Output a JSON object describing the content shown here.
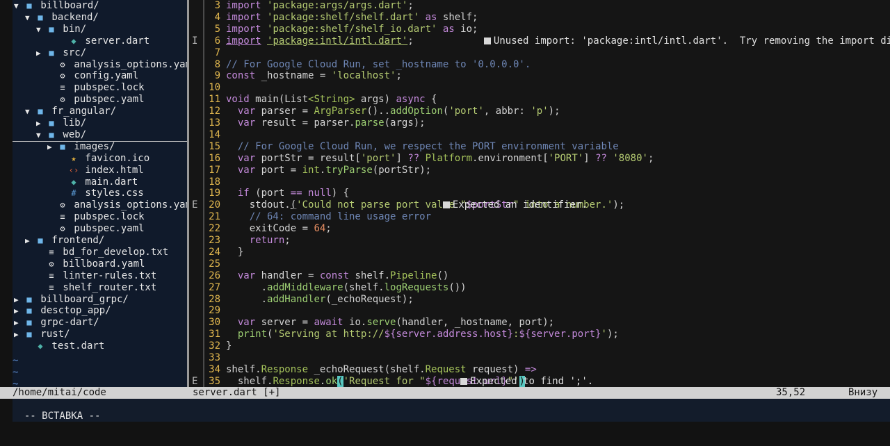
{
  "file_tree": {
    "rows": [
      {
        "arrow": "▼",
        "icon": "■",
        "icon_color": "#6fb6e9",
        "label": "billboard/",
        "indent": 0
      },
      {
        "arrow": "▼",
        "icon": "■",
        "icon_color": "#6fb6e9",
        "label": "backend/",
        "indent": 1
      },
      {
        "arrow": "▼",
        "icon": "■",
        "icon_color": "#6fb6e9",
        "label": "bin/",
        "indent": 2
      },
      {
        "arrow": "",
        "icon": "◆",
        "icon_color": "#4fb3a9",
        "label": "server.dart",
        "indent": 4
      },
      {
        "arrow": "▶",
        "icon": "■",
        "icon_color": "#6fb6e9",
        "label": "src/",
        "indent": 2
      },
      {
        "arrow": "",
        "icon": "⚙",
        "icon_color": "#e6e6e6",
        "label": "analysis_options.yaml",
        "indent": 3
      },
      {
        "arrow": "",
        "icon": "⚙",
        "icon_color": "#e6e6e6",
        "label": "config.yaml",
        "indent": 3
      },
      {
        "arrow": "",
        "icon": "≡",
        "icon_color": "#e6e6e6",
        "label": "pubspec.lock",
        "indent": 3
      },
      {
        "arrow": "",
        "icon": "⚙",
        "icon_color": "#e6e6e6",
        "label": "pubspec.yaml",
        "indent": 3
      },
      {
        "arrow": "▼",
        "icon": "■",
        "icon_color": "#6fb6e9",
        "label": "fr_angular/",
        "indent": 1
      },
      {
        "arrow": "▶",
        "icon": "■",
        "icon_color": "#6fb6e9",
        "label": "lib/",
        "indent": 2
      },
      {
        "arrow": "▼",
        "icon": "■",
        "icon_color": "#6fb6e9",
        "label": "web/",
        "indent": 2,
        "highlight": true
      },
      {
        "arrow": "▶",
        "icon": "■",
        "icon_color": "#6fb6e9",
        "label": "images/",
        "indent": 3
      },
      {
        "arrow": "",
        "icon": "★",
        "icon_color": "#e5b33f",
        "label": "favicon.ico",
        "indent": 4
      },
      {
        "arrow": "",
        "icon": "‹›",
        "icon_color": "#e3653b",
        "label": "index.html",
        "indent": 4
      },
      {
        "arrow": "",
        "icon": "◆",
        "icon_color": "#4fb3a9",
        "label": "main.dart",
        "indent": 4
      },
      {
        "arrow": "",
        "icon": "#",
        "icon_color": "#5b9bd5",
        "label": "styles.css",
        "indent": 4
      },
      {
        "arrow": "",
        "icon": "⚙",
        "icon_color": "#e6e6e6",
        "label": "analysis_options.yaml",
        "indent": 3
      },
      {
        "arrow": "",
        "icon": "≡",
        "icon_color": "#e6e6e6",
        "label": "pubspec.lock",
        "indent": 3
      },
      {
        "arrow": "",
        "icon": "⚙",
        "icon_color": "#e6e6e6",
        "label": "pubspec.yaml",
        "indent": 3
      },
      {
        "arrow": "▶",
        "icon": "■",
        "icon_color": "#6fb6e9",
        "label": "frontend/",
        "indent": 1
      },
      {
        "arrow": "",
        "icon": "≡",
        "icon_color": "#e6e6e6",
        "label": "bd_for_develop.txt",
        "indent": 2
      },
      {
        "arrow": "",
        "icon": "⚙",
        "icon_color": "#e6e6e6",
        "label": "billboard.yaml",
        "indent": 2
      },
      {
        "arrow": "",
        "icon": "≡",
        "icon_color": "#e6e6e6",
        "label": "linter-rules.txt",
        "indent": 2
      },
      {
        "arrow": "",
        "icon": "≡",
        "icon_color": "#e6e6e6",
        "label": "shelf_router.txt",
        "indent": 2
      },
      {
        "arrow": "▶",
        "icon": "■",
        "icon_color": "#6fb6e9",
        "label": "billboard_grpc/",
        "indent": 0
      },
      {
        "arrow": "▶",
        "icon": "■",
        "icon_color": "#6fb6e9",
        "label": "desctop_app/",
        "indent": 0
      },
      {
        "arrow": "▶",
        "icon": "■",
        "icon_color": "#6fb6e9",
        "label": "grpc-dart/",
        "indent": 0
      },
      {
        "arrow": "▶",
        "icon": "■",
        "icon_color": "#6fb6e9",
        "label": "rust/",
        "indent": 0
      },
      {
        "arrow": "",
        "icon": "◆",
        "icon_color": "#4fb3a9",
        "label": "test.dart",
        "indent": 1
      }
    ],
    "tildes": [
      "~",
      "~",
      "~"
    ]
  },
  "editor": {
    "lines": [
      {
        "num": "3",
        "sign": "",
        "segments": [
          {
            "t": "import",
            "c": "k"
          },
          {
            "t": " "
          },
          {
            "t": "'package:args/args.dart'",
            "c": "s"
          },
          {
            "t": ";"
          }
        ]
      },
      {
        "num": "4",
        "sign": "",
        "segments": [
          {
            "t": "import",
            "c": "k"
          },
          {
            "t": " "
          },
          {
            "t": "'package:shelf/shelf.dart'",
            "c": "s"
          },
          {
            "t": " as ",
            "c": "k"
          },
          {
            "t": "shelf;"
          }
        ]
      },
      {
        "num": "5",
        "sign": "",
        "segments": [
          {
            "t": "import",
            "c": "k"
          },
          {
            "t": " "
          },
          {
            "t": "'package:shelf/shelf_io.dart'",
            "c": "s"
          },
          {
            "t": " as ",
            "c": "k"
          },
          {
            "t": "io;"
          }
        ]
      },
      {
        "num": "6",
        "sign": "I",
        "segments": [
          {
            "t": "import",
            "c": "k ul"
          },
          {
            "t": " "
          },
          {
            "t": "'package:intl/intl.dart'",
            "c": "s ul"
          },
          {
            "t": ";"
          }
        ],
        "diag": "Unused import: 'package:intl/intl.dart'.  Try removing the import directive.",
        "diag_col": 44
      },
      {
        "num": "7",
        "sign": "",
        "segments": []
      },
      {
        "num": "8",
        "sign": "",
        "segments": [
          {
            "t": "// For Google Cloud Run, set _hostname to '0.0.0.0'.",
            "c": "c"
          }
        ]
      },
      {
        "num": "9",
        "sign": "",
        "segments": [
          {
            "t": "const",
            "c": "k"
          },
          {
            "t": " _hostname = "
          },
          {
            "t": "'localhost'",
            "c": "s"
          },
          {
            "t": ";"
          }
        ]
      },
      {
        "num": "10",
        "sign": "",
        "segments": []
      },
      {
        "num": "11",
        "sign": "",
        "segments": [
          {
            "t": "void",
            "c": "k"
          },
          {
            "t": " main(List"
          },
          {
            "t": "<String>",
            "c": "cl"
          },
          {
            "t": " args) "
          },
          {
            "t": "async",
            "c": "k"
          },
          {
            "t": " {"
          }
        ]
      },
      {
        "num": "12",
        "sign": "",
        "segments": [
          {
            "t": "  "
          },
          {
            "t": "var",
            "c": "k"
          },
          {
            "t": " parser = "
          },
          {
            "t": "ArgParser",
            "c": "cl"
          },
          {
            "t": "().."
          },
          {
            "t": "addOption",
            "c": "f"
          },
          {
            "t": "("
          },
          {
            "t": "'port'",
            "c": "s"
          },
          {
            "t": ", abbr: "
          },
          {
            "t": "'p'",
            "c": "s"
          },
          {
            "t": ");"
          }
        ]
      },
      {
        "num": "13",
        "sign": "",
        "segments": [
          {
            "t": "  "
          },
          {
            "t": "var",
            "c": "k"
          },
          {
            "t": " result = parser."
          },
          {
            "t": "parse",
            "c": "f"
          },
          {
            "t": "(args);"
          }
        ]
      },
      {
        "num": "14",
        "sign": "",
        "segments": []
      },
      {
        "num": "15",
        "sign": "",
        "segments": [
          {
            "t": "  // For Google Cloud Run, we respect the PORT environment variable",
            "c": "c"
          }
        ]
      },
      {
        "num": "16",
        "sign": "",
        "segments": [
          {
            "t": "  "
          },
          {
            "t": "var",
            "c": "k"
          },
          {
            "t": " portStr = result["
          },
          {
            "t": "'port'",
            "c": "s"
          },
          {
            "t": "] "
          },
          {
            "t": "??",
            "c": "k"
          },
          {
            "t": " "
          },
          {
            "t": "Platform",
            "c": "cl"
          },
          {
            "t": ".environment["
          },
          {
            "t": "'PORT'",
            "c": "s"
          },
          {
            "t": "] "
          },
          {
            "t": "??",
            "c": "k"
          },
          {
            "t": " "
          },
          {
            "t": "'8080'",
            "c": "s"
          },
          {
            "t": ";"
          }
        ]
      },
      {
        "num": "17",
        "sign": "",
        "segments": [
          {
            "t": "  "
          },
          {
            "t": "var",
            "c": "k"
          },
          {
            "t": " port = "
          },
          {
            "t": "int",
            "c": "cl"
          },
          {
            "t": "."
          },
          {
            "t": "tryParse",
            "c": "f"
          },
          {
            "t": "(portStr);"
          }
        ]
      },
      {
        "num": "18",
        "sign": "",
        "segments": []
      },
      {
        "num": "19",
        "sign": "",
        "segments": [
          {
            "t": "  "
          },
          {
            "t": "if",
            "c": "k"
          },
          {
            "t": " (port "
          },
          {
            "t": "==",
            "c": "k"
          },
          {
            "t": " "
          },
          {
            "t": "null",
            "c": "k"
          },
          {
            "t": ") {"
          }
        ]
      },
      {
        "num": "20",
        "sign": "E",
        "segments": [
          {
            "t": "    stdout."
          },
          {
            "t": "(",
            "c": "ul"
          },
          {
            "t": "'Could not parse port value \"",
            "c": "s"
          },
          {
            "t": "$portStr",
            "c": "k"
          },
          {
            "t": "\" into a number.'",
            "c": "s"
          },
          {
            "t": ");"
          }
        ],
        "diag": "Expected an identifier.",
        "diag_col": 37
      },
      {
        "num": "21",
        "sign": "",
        "segments": [
          {
            "t": "    // 64: command line usage error",
            "c": "c"
          }
        ]
      },
      {
        "num": "22",
        "sign": "",
        "segments": [
          {
            "t": "    exitCode = "
          },
          {
            "t": "64",
            "c": "n"
          },
          {
            "t": ";"
          }
        ]
      },
      {
        "num": "23",
        "sign": "",
        "segments": [
          {
            "t": "    "
          },
          {
            "t": "return",
            "c": "k"
          },
          {
            "t": ";"
          }
        ]
      },
      {
        "num": "24",
        "sign": "",
        "segments": [
          {
            "t": "  }"
          }
        ]
      },
      {
        "num": "25",
        "sign": "",
        "segments": []
      },
      {
        "num": "26",
        "sign": "",
        "segments": [
          {
            "t": "  "
          },
          {
            "t": "var",
            "c": "k"
          },
          {
            "t": " handler = "
          },
          {
            "t": "const",
            "c": "k"
          },
          {
            "t": " shelf."
          },
          {
            "t": "Pipeline",
            "c": "cl"
          },
          {
            "t": "()"
          }
        ]
      },
      {
        "num": "27",
        "sign": "",
        "segments": [
          {
            "t": "      ."
          },
          {
            "t": "addMiddleware",
            "c": "f"
          },
          {
            "t": "(shelf."
          },
          {
            "t": "logRequests",
            "c": "f"
          },
          {
            "t": "())"
          }
        ]
      },
      {
        "num": "28",
        "sign": "",
        "segments": [
          {
            "t": "      ."
          },
          {
            "t": "addHandler",
            "c": "f"
          },
          {
            "t": "(_echoRequest);"
          }
        ]
      },
      {
        "num": "29",
        "sign": "",
        "segments": []
      },
      {
        "num": "30",
        "sign": "",
        "segments": [
          {
            "t": "  "
          },
          {
            "t": "var",
            "c": "k"
          },
          {
            "t": " server = "
          },
          {
            "t": "await",
            "c": "k"
          },
          {
            "t": " io."
          },
          {
            "t": "serve",
            "c": "f"
          },
          {
            "t": "(handler, _hostname, port);"
          }
        ]
      },
      {
        "num": "31",
        "sign": "",
        "segments": [
          {
            "t": "  "
          },
          {
            "t": "print",
            "c": "f"
          },
          {
            "t": "("
          },
          {
            "t": "'Serving at http://",
            "c": "s"
          },
          {
            "t": "${server.address.host}",
            "c": "k"
          },
          {
            "t": ":",
            "c": "s"
          },
          {
            "t": "${server.port}",
            "c": "k"
          },
          {
            "t": "'",
            "c": "s"
          },
          {
            "t": ");"
          }
        ]
      },
      {
        "num": "32",
        "sign": "",
        "segments": [
          {
            "t": "}"
          }
        ]
      },
      {
        "num": "33",
        "sign": "",
        "segments": []
      },
      {
        "num": "34",
        "sign": "",
        "segments": [
          {
            "t": "shelf."
          },
          {
            "t": "Response",
            "c": "cl"
          },
          {
            "t": " _echoRequest(shelf."
          },
          {
            "t": "Request",
            "c": "cl"
          },
          {
            "t": " request) "
          },
          {
            "t": "=>",
            "c": "k"
          }
        ]
      },
      {
        "num": "35",
        "sign": "E",
        "segments": [
          {
            "t": "  shelf."
          },
          {
            "t": "Response",
            "c": "cl"
          },
          {
            "t": "."
          },
          {
            "t": "ok",
            "c": "f"
          },
          {
            "t": "(",
            "c": "cur"
          },
          {
            "t": "'Request for \"",
            "c": "s"
          },
          {
            "t": "${request.url}",
            "c": "k"
          },
          {
            "t": "\"'",
            "c": "s"
          },
          {
            "t": ")",
            "c": "cur"
          }
        ],
        "diag": "Expected to find ';'.",
        "diag_col": 40
      }
    ]
  },
  "statusbar": {
    "left": "/home/mitai/code",
    "file": "server.dart [+]",
    "position": "35,52",
    "scroll": "Внизу"
  },
  "cmdline": {
    "mode": "-- ВСТАВКА --"
  }
}
